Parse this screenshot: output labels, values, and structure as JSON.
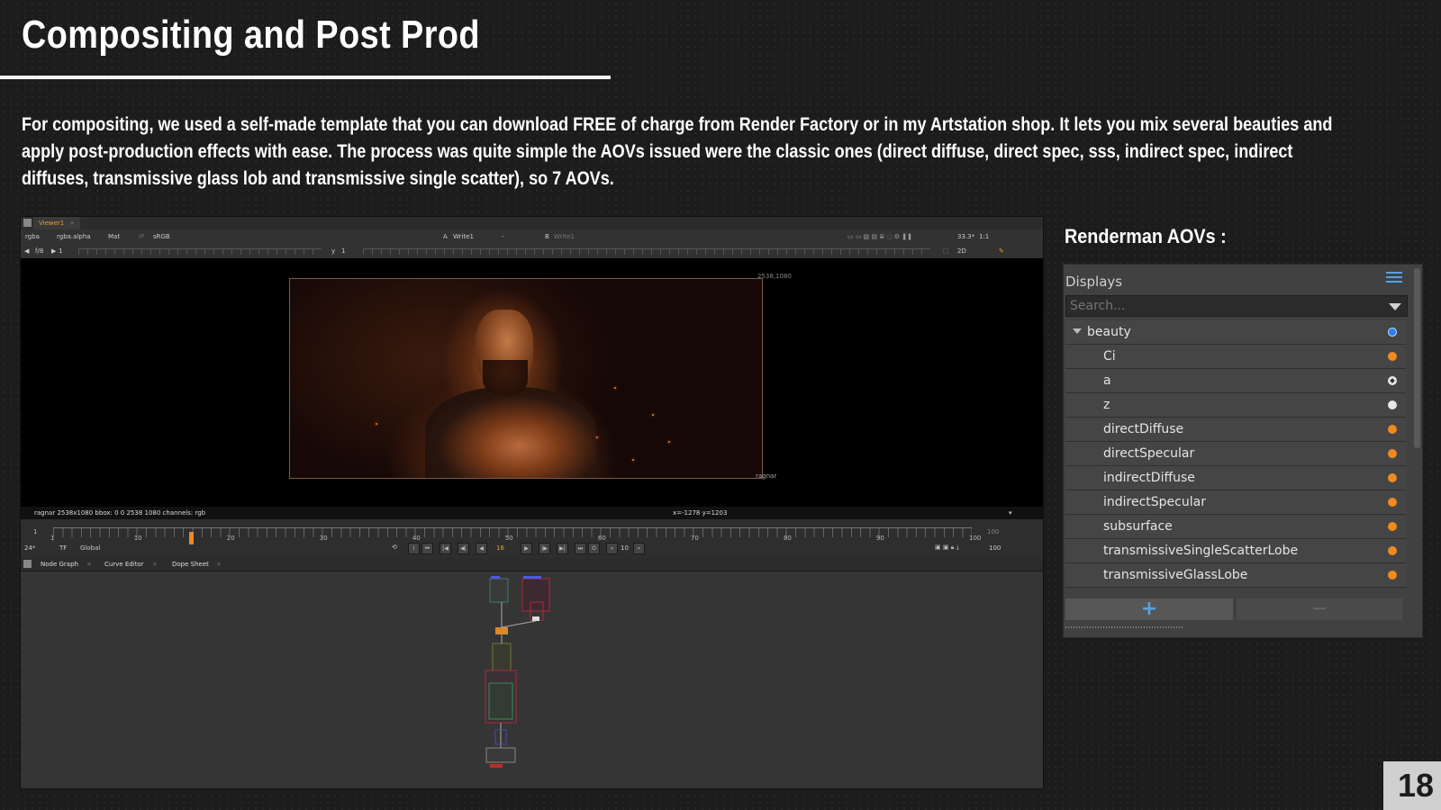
{
  "slide": {
    "title": "Compositing and Post Prod",
    "intro": "For compositing, we used a self-made template that you can download FREE of charge from Render Factory or in my Artstation shop. It lets you mix several beauties and apply post-production effects with ease. The process was quite simple the AOVs issued were the classic ones (direct diffuse, direct spec, sss, indirect spec, indirect diffuses, transmissive glass lob and transmissive single scatter), so 7 AOVs.",
    "page_number": "18"
  },
  "nuke": {
    "viewer_tab": "Viewer1",
    "viewer_toolbar": {
      "channels": "rgba",
      "alpha": "rgba.alpha",
      "mat": "Mat",
      "ip": "IP",
      "lut": "sRGB",
      "a_label": "A",
      "a_input": "Write1",
      "dash": "-",
      "b_label": "B",
      "b_input": "Write1",
      "zoom": "33.3*",
      "ratio": "1:1"
    },
    "viewer_row2": {
      "fstop": "f/8",
      "frame_step": "1",
      "y_label": "y",
      "y_value": "1",
      "view_mode": "2D"
    },
    "frame": {
      "resolution_label": "2538,1080",
      "node_label": "ragnar"
    },
    "status": {
      "info": "ragnar 2538x1080  bbox: 0 0 2538 1080 channels: rgb",
      "coords": "x=-1278 y=1203"
    },
    "timeline": {
      "start": "1",
      "end": "100",
      "ticks": [
        "1",
        "10",
        "20",
        "30",
        "40",
        "50",
        "60",
        "70",
        "80",
        "90",
        "100"
      ],
      "current_frame": "16",
      "current_frame_ratio": 0.15
    },
    "controls": {
      "fps": "24*",
      "tf": "TF",
      "scope": "Global",
      "increment": "10",
      "end_frame": "100"
    },
    "bottom_tabs": [
      "Node Graph",
      "Curve Editor",
      "Dope Sheet"
    ]
  },
  "aov_panel": {
    "heading": "Renderman AOVs :",
    "title": "Displays",
    "search_placeholder": "Search...",
    "group": {
      "label": "beauty",
      "dot": "blue"
    },
    "items": [
      {
        "label": "Ci",
        "dot": "orange"
      },
      {
        "label": "a",
        "dot": "diamond"
      },
      {
        "label": "z",
        "dot": "white"
      },
      {
        "label": "directDiffuse",
        "dot": "orange"
      },
      {
        "label": "directSpecular",
        "dot": "orange"
      },
      {
        "label": "indirectDiffuse",
        "dot": "orange"
      },
      {
        "label": "indirectSpecular",
        "dot": "orange"
      },
      {
        "label": "subsurface",
        "dot": "orange"
      },
      {
        "label": "transmissiveSingleScatterLobe",
        "dot": "orange"
      },
      {
        "label": "transmissiveGlassLobe",
        "dot": "orange"
      }
    ],
    "add_label": "+",
    "remove_label": "−"
  },
  "colors": {
    "background": "#1c1c1c",
    "accent_blue": "#2a7fe8",
    "accent_orange": "#f08a1e",
    "nuke_orange": "#e59a3a"
  }
}
